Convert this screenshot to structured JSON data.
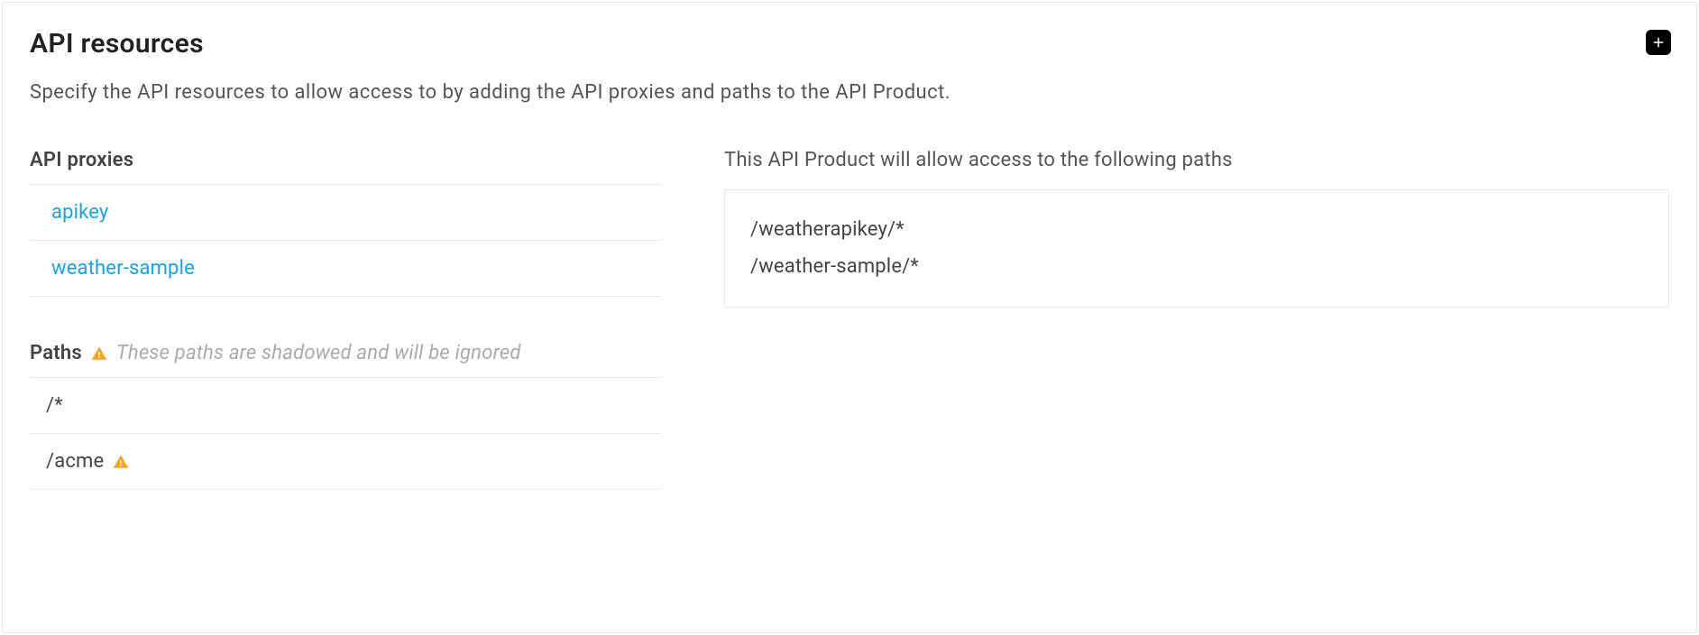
{
  "header": {
    "title": "API resources",
    "description": "Specify the API resources to allow access to by adding the API proxies and paths to the API Product."
  },
  "proxies": {
    "label": "API proxies",
    "items": [
      "apikey",
      "weather-sample"
    ]
  },
  "paths": {
    "label": "Paths",
    "warning_note": "These paths are shadowed and will be ignored",
    "items": [
      {
        "path": "/*",
        "warn": false
      },
      {
        "path": "/acme",
        "warn": true
      }
    ]
  },
  "allowed": {
    "label": "This API Product will allow access to the following paths",
    "items": [
      "/weatherapikey/*",
      "/weather-sample/*"
    ]
  }
}
